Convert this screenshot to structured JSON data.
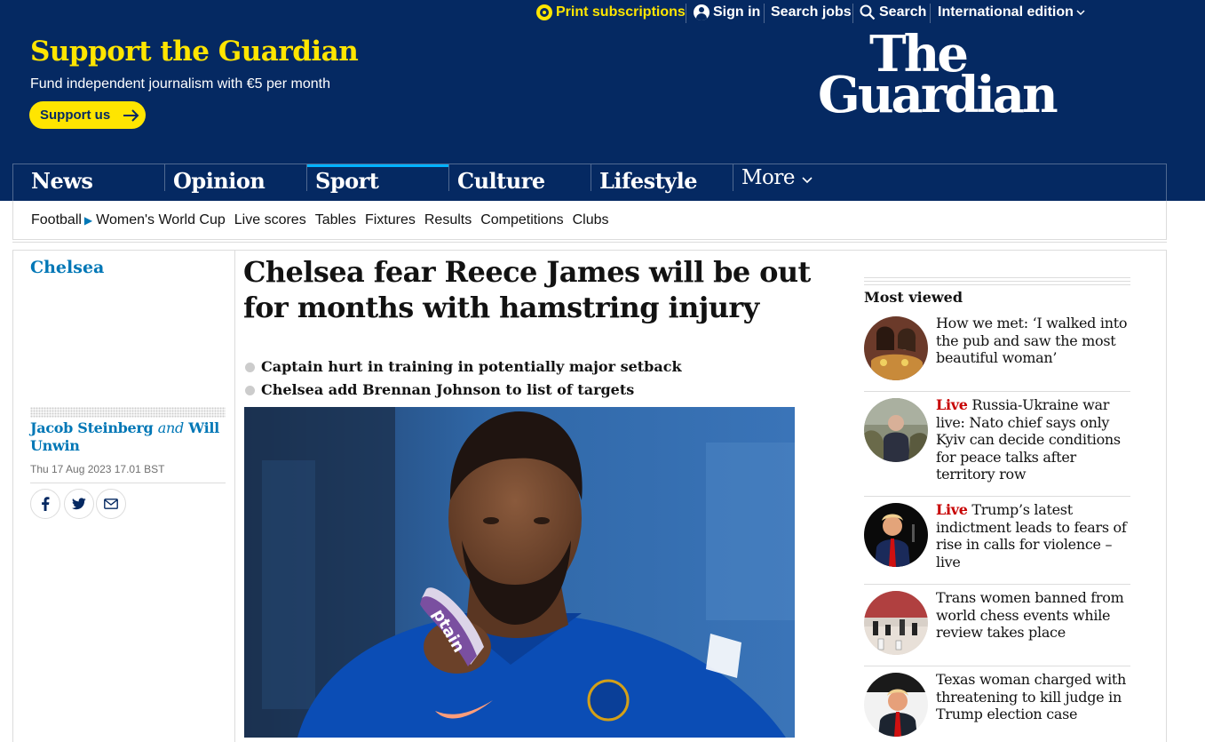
{
  "topbar": {
    "print": "Print subscriptions",
    "signin": "Sign in",
    "jobs": "Search jobs",
    "search": "Search",
    "edition": "International edition"
  },
  "masthead": {
    "support_title": "Support the Guardian",
    "support_sub": "Fund independent journalism with €5 per month",
    "support_button": "Support us",
    "logo_line1": "The",
    "logo_line2": "Guardian"
  },
  "pillars": [
    "News",
    "Opinion",
    "Sport",
    "Culture",
    "Lifestyle"
  ],
  "pillar_more": "More",
  "selected_pillar": "Sport",
  "subnav": {
    "first": "Football",
    "items": [
      "Women's World Cup",
      "Live scores",
      "Tables",
      "Fixtures",
      "Results",
      "Competitions",
      "Clubs"
    ]
  },
  "article": {
    "section": "Chelsea",
    "headline": "Chelsea fear Reece James will be out for months with hamstring injury",
    "standfirst": [
      "Captain hurt in training in potentially major setback",
      "Chelsea add Brennan Johnson to list of targets"
    ],
    "author1": "Jacob Steinberg",
    "author_and": "and",
    "author2": "Will Unwin",
    "date": "Thu 17 Aug 2023 17.01 BST",
    "image_armband_text": "ptain"
  },
  "most_viewed": {
    "title": "Most viewed",
    "live_label": "Live",
    "items": [
      {
        "live": false,
        "text": "How we met: ‘I walked into the pub and saw the most beautiful woman’"
      },
      {
        "live": true,
        "text": "Russia-Ukraine war live: Nato chief says only Kyiv can decide conditions for peace talks after territory row"
      },
      {
        "live": true,
        "text": "Trump’s latest indictment leads to fears of rise in calls for violence – live"
      },
      {
        "live": false,
        "text": "Trans women banned from world chess events while review takes place"
      },
      {
        "live": false,
        "text": "Texas woman charged with threatening to kill judge in Trump election case"
      }
    ]
  },
  "colors": {
    "brand_blue": "#052962",
    "brand_yellow": "#ffe500",
    "sport_accent": "#00b2ff",
    "sport_link": "#0077b6",
    "live_red": "#c70000"
  },
  "icons": [
    "yellow-circle-icon",
    "profile-icon",
    "search-icon",
    "chevron-down-icon",
    "arrow-right-icon",
    "play-triangle-icon",
    "facebook-icon",
    "twitter-icon",
    "email-icon"
  ]
}
